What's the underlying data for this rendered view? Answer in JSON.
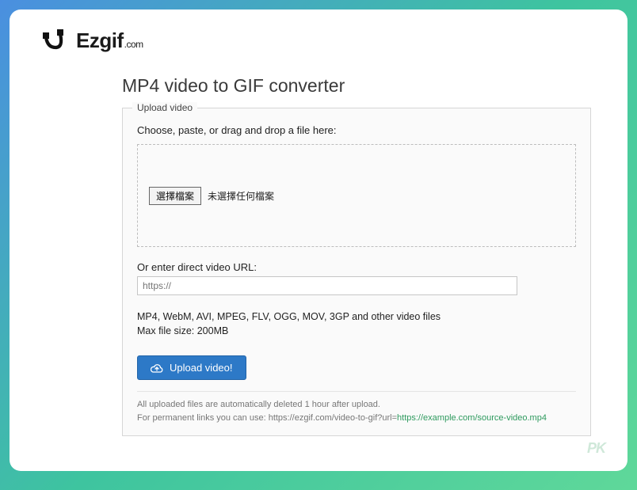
{
  "logo": {
    "text": "Ezgif",
    "suffix": ".com"
  },
  "title": "MP4 video to GIF converter",
  "panel": {
    "legend": "Upload video",
    "instruction": "Choose, paste, or drag and drop a file here:",
    "file_button_label": "選擇檔案",
    "file_status": "未選擇任何檔案",
    "url_label": "Or enter direct video URL:",
    "url_placeholder": "https://",
    "formats_line": "MP4, WebM, AVI, MPEG, FLV, OGG, MOV, 3GP and other video files",
    "maxsize_line": "Max file size: 200MB",
    "upload_button": "Upload video!",
    "footer_deleted": "All uploaded files are automatically deleted 1 hour after upload.",
    "footer_permalink_prefix": "For permanent links you can use: ",
    "footer_permalink_base": "https://ezgif.com/video-to-gif?url=",
    "footer_permalink_example": "https://example.com/source-video.mp4"
  },
  "watermark": "PK"
}
